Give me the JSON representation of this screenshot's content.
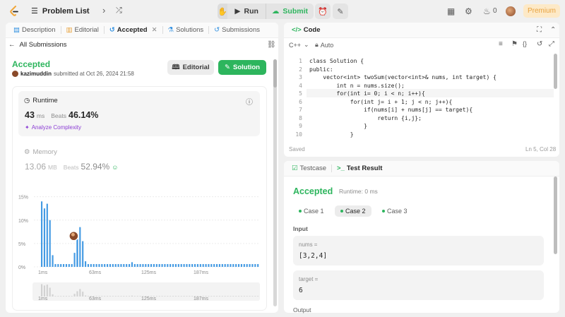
{
  "topbar": {
    "problem_list": "Problem List",
    "run": "Run",
    "submit": "Submit",
    "fire_count": "0",
    "premium": "Premium"
  },
  "left": {
    "tabs": [
      {
        "label": "Description"
      },
      {
        "label": "Editorial"
      },
      {
        "label": "Accepted"
      },
      {
        "label": "Solutions"
      },
      {
        "label": "Submissions"
      }
    ],
    "all_submissions": "All Submissions",
    "status": "Accepted",
    "user": "kazimuddin",
    "submitted_text": "submitted at Oct 26, 2024 21:58",
    "editorial_btn": "Editorial",
    "solution_btn": "Solution",
    "runtime": {
      "label": "Runtime",
      "value": "43",
      "unit": "ms",
      "beats_label": "Beats",
      "beats": "46.14%",
      "analyze": "Analyze Complexity"
    },
    "memory": {
      "label": "Memory",
      "value": "13.06",
      "unit": "MB",
      "beats_label": "Beats",
      "beats": "52.94%"
    }
  },
  "chart_data": {
    "type": "bar",
    "ytick_labels": [
      "15%",
      "10%",
      "5%",
      "0%"
    ],
    "ylim": [
      0,
      16
    ],
    "xtick_labels": [
      "1ms",
      "63ms",
      "125ms",
      "187ms"
    ],
    "values": [
      14,
      12.5,
      13.5,
      10,
      2.5,
      0.6,
      0.6,
      0.6,
      0.6,
      0.6,
      0.6,
      0.6,
      3,
      6,
      8.5,
      5.5,
      1.2,
      0.6,
      0.6,
      0.6,
      0.6,
      0.6,
      0.6,
      0.6,
      0.6,
      0.6,
      0.6,
      0.6,
      0.6,
      0.6,
      0.6,
      0.6,
      0.6,
      1.0,
      0.6,
      0.6,
      0.6,
      0.6,
      0.6,
      0.6,
      0.6,
      0.6,
      0.6,
      0.6,
      0.6,
      0.6,
      0.6,
      0.6,
      0.6,
      0.6,
      0.6,
      0.6,
      0.6,
      0.6,
      0.6,
      0.6,
      0.6,
      0.6,
      0.6,
      0.6,
      0.6,
      0.6,
      0.6,
      0.6,
      0.6,
      0.6,
      0.6,
      0.6,
      0.6,
      0.6,
      0.6,
      0.6,
      0.6,
      0.6,
      0.6,
      0.6,
      0.6,
      0.6,
      0.6,
      0.6
    ],
    "highlight_index": 13,
    "bar_color": "#2f8fe0",
    "mini_xtick_labels": [
      "1ms",
      "63ms",
      "125ms",
      "187ms"
    ]
  },
  "right": {
    "code_tab": "Code",
    "language": "C++",
    "auto": "Auto",
    "lines": [
      "1",
      "2",
      "3",
      "4",
      "5",
      "6",
      "7",
      "8",
      "9",
      "10"
    ],
    "saved": "Saved",
    "cursor": "Ln 5, Col 28",
    "testcase_tab": "Testcase",
    "result_tab": "Test Result",
    "result_status": "Accepted",
    "result_runtime": "Runtime: 0 ms",
    "cases": [
      {
        "label": "Case 1"
      },
      {
        "label": "Case 2"
      },
      {
        "label": "Case 3"
      }
    ],
    "input_label": "Input",
    "nums_label": "nums =",
    "nums_value": "[3,2,4]",
    "target_label": "target =",
    "target_value": "6",
    "output_label": "Output"
  },
  "code_lines": [
    "class Solution {",
    "public:",
    "    vector<int> twoSum(vector<int>& nums, int target) {",
    "        int n = nums.size();",
    "        for(int i= 0; i < n; i++){",
    "            for(int j= i + 1; j < n; j++){",
    "                if(nums[i] + nums[j] == target){",
    "                    return {i,j};",
    "                }",
    "            }"
  ],
  "colors": {
    "accent_green": "#2db55d",
    "brand_orange": "#e8a23e",
    "bar_blue": "#2f8fe0"
  }
}
